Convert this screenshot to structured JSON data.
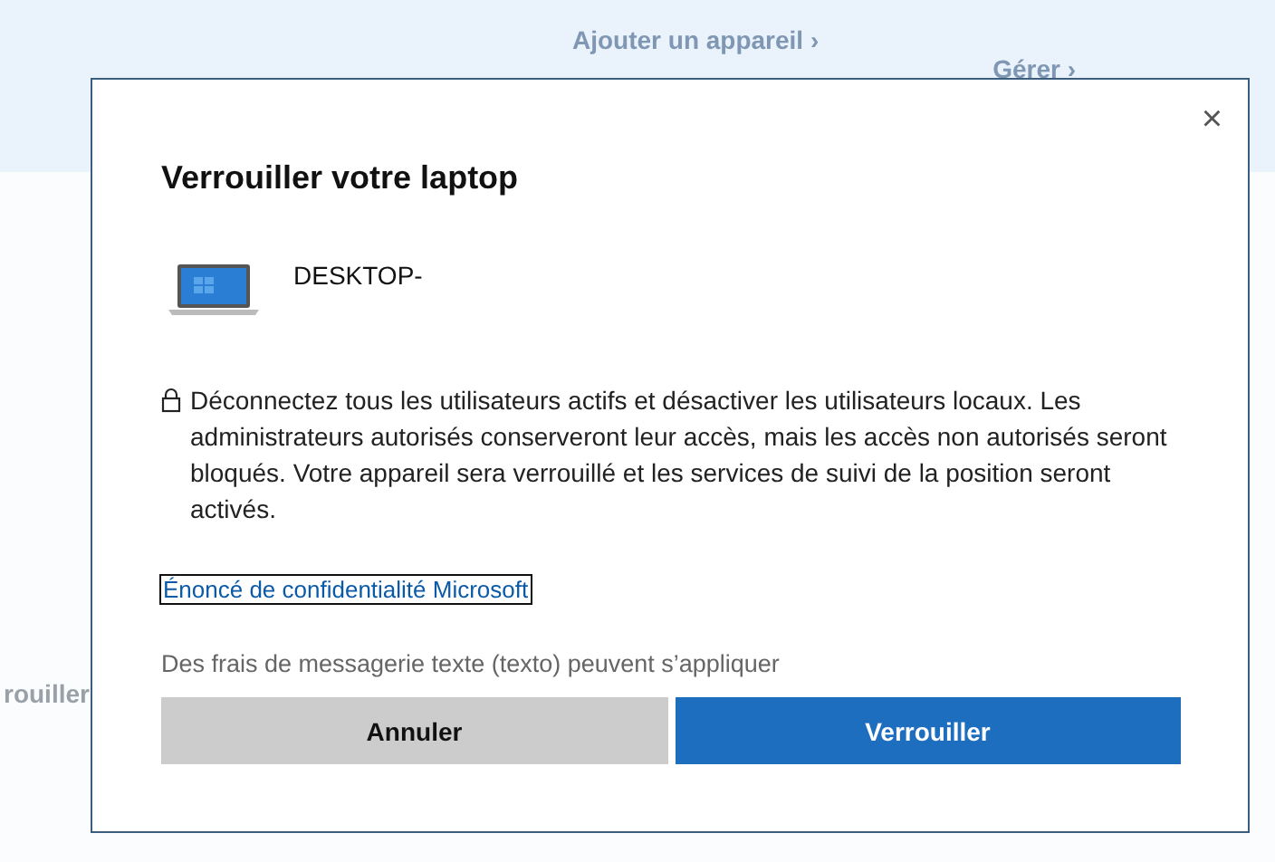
{
  "background": {
    "add_device_link": "Ajouter un appareil ›",
    "manage_link": "Gérer ›",
    "lock_label": "rouiller"
  },
  "dialog": {
    "close": "×",
    "title": "Verrouiller votre laptop",
    "device_name": "DESKTOP-",
    "message": "Déconnectez tous les utilisateurs actifs et désactiver les utilisateurs locaux. Les administrateurs autorisés conserveront leur accès, mais les accès non autorisés seront bloqués. Votre appareil sera verrouillé et les services de suivi de la position seront activés.",
    "privacy_link": "Énoncé de confidentialité Microsoft",
    "sms_note": "Des frais de messagerie texte (texto) peuvent s’appliquer",
    "buttons": [
      {
        "label": "Annuler",
        "kind": "secondary"
      },
      {
        "label": "Verrouiller",
        "kind": "primary"
      }
    ]
  }
}
